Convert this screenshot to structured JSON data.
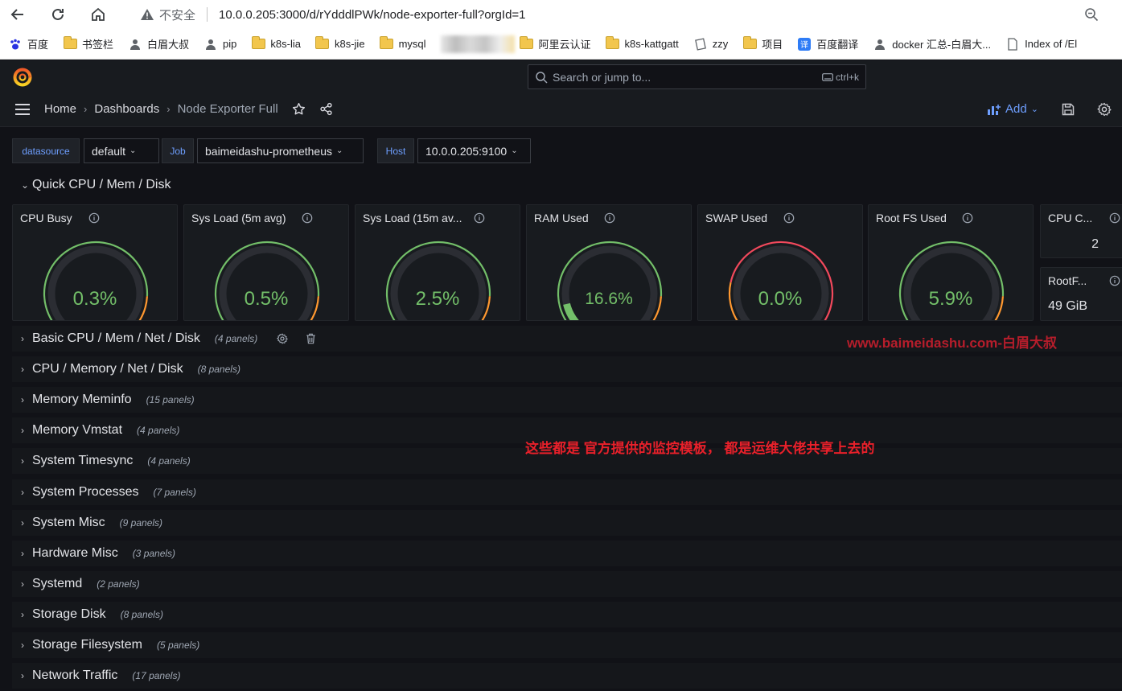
{
  "browser": {
    "security_label": "不安全",
    "url": "10.0.0.205:3000/d/rYdddlPWk/node-exporter-full?orgId=1"
  },
  "bookmarks": [
    {
      "label": "百度",
      "icon": "baidu-paw-icon"
    },
    {
      "label": "书签栏",
      "icon": "folder-icon"
    },
    {
      "label": "白眉大叔",
      "icon": "person-icon"
    },
    {
      "label": "pip",
      "icon": "person-icon"
    },
    {
      "label": "k8s-lia",
      "icon": "folder-icon"
    },
    {
      "label": "k8s-jie",
      "icon": "folder-icon"
    },
    {
      "label": "mysql",
      "icon": "folder-icon"
    },
    {
      "label": "阿里云认证",
      "icon": "folder-icon"
    },
    {
      "label": "k8s-kattgatt",
      "icon": "folder-icon"
    },
    {
      "label": "zzy",
      "icon": "page-icon"
    },
    {
      "label": "项目",
      "icon": "folder-icon"
    },
    {
      "label": "百度翻译",
      "icon": "translate-icon"
    },
    {
      "label": "docker 汇总-白眉大...",
      "icon": "person-icon"
    },
    {
      "label": "Index of /El",
      "icon": "document-icon"
    }
  ],
  "grafana": {
    "search_placeholder": "Search or jump to...",
    "search_shortcut": "ctrl+k",
    "breadcrumbs": [
      "Home",
      "Dashboards",
      "Node Exporter Full"
    ],
    "add_label": "Add"
  },
  "variables": {
    "datasource": {
      "label": "datasource",
      "value": "default"
    },
    "job": {
      "label": "Job",
      "value": "baimeidashu-prometheus"
    },
    "host": {
      "label": "Host",
      "value": "10.0.0.205:9100"
    }
  },
  "quick_row": {
    "title": "Quick CPU / Mem / Disk"
  },
  "gauges": [
    {
      "title": "CPU Busy",
      "value": "0.3%",
      "fraction": 0.003
    },
    {
      "title": "Sys Load (5m avg)",
      "value": "0.5%",
      "fraction": 0.005
    },
    {
      "title": "Sys Load (15m av...",
      "value": "2.5%",
      "fraction": 0.025
    },
    {
      "title": "RAM Used",
      "value": "16.6%",
      "fraction": 0.166
    },
    {
      "title": "SWAP Used",
      "value": "0.0%",
      "fraction": 0.0
    },
    {
      "title": "Root FS Used",
      "value": "5.9%",
      "fraction": 0.059
    }
  ],
  "stats": [
    {
      "title": "CPU C...",
      "value": "2"
    },
    {
      "title": "RootF...",
      "value": "49 GiB"
    }
  ],
  "collapsed_rows": [
    {
      "title": "Basic CPU / Mem / Net / Disk",
      "count": "(4 panels)"
    },
    {
      "title": "CPU / Memory / Net / Disk",
      "count": "(8 panels)"
    },
    {
      "title": "Memory Meminfo",
      "count": "(15 panels)"
    },
    {
      "title": "Memory Vmstat",
      "count": "(4 panels)"
    },
    {
      "title": "System Timesync",
      "count": "(4 panels)"
    },
    {
      "title": "System Processes",
      "count": "(7 panels)"
    },
    {
      "title": "System Misc",
      "count": "(9 panels)"
    },
    {
      "title": "Hardware Misc",
      "count": "(3 panels)"
    },
    {
      "title": "Systemd",
      "count": "(2 panels)"
    },
    {
      "title": "Storage Disk",
      "count": "(8 panels)"
    },
    {
      "title": "Storage Filesystem",
      "count": "(5 panels)"
    },
    {
      "title": "Network Traffic",
      "count": "(17 panels)"
    }
  ],
  "annotations": {
    "watermark": "www.baimeidashu.com-白眉大叔",
    "note": "这些都是 官方提供的监控模板， 都是运维大佬共享上去的"
  },
  "colors": {
    "gauge_green": "#73bf69",
    "gauge_orange": "#ff9830",
    "gauge_red": "#f2495c",
    "track": "#2b2d33",
    "link_blue": "#6e9fff"
  }
}
